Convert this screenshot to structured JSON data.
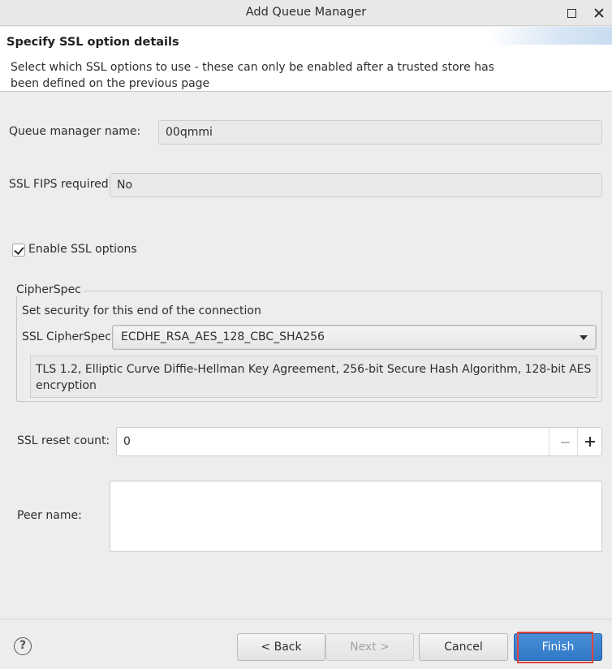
{
  "window": {
    "title": "Add Queue Manager",
    "maximize_icon": "maximize-icon",
    "close_icon": "close-icon"
  },
  "header": {
    "heading": "Specify SSL option details",
    "description": "Select which SSL options to use - these can only be enabled after a trusted store has been defined on the previous page"
  },
  "form": {
    "queue_manager_label": "Queue manager name:",
    "queue_manager_value": "00qmmi",
    "fips_label": "SSL FIPS required:",
    "fips_value": "No",
    "enable_ssl_label": "Enable SSL options",
    "enable_ssl_checked": true,
    "cipherspec": {
      "group_title": "CipherSpec",
      "group_desc": "Set security for this end of the connection",
      "label": "SSL CipherSpec:",
      "selected": "ECDHE_RSA_AES_128_CBC_SHA256",
      "details": "TLS 1.2, Elliptic Curve Diffie-Hellman Key Agreement, 256-bit Secure Hash Algorithm, 128-bit AES encryption"
    },
    "reset_count_label": "SSL reset count:",
    "reset_count_value": "0",
    "peer_name_label": "Peer name:",
    "peer_name_value": ""
  },
  "footer": {
    "help_icon": "help-icon",
    "help_glyph": "?",
    "back_label": "< Back",
    "next_label": "Next >",
    "cancel_label": "Cancel",
    "finish_label": "Finish",
    "accent_color": "#3584e4",
    "highlight_color": "#e0463f"
  }
}
